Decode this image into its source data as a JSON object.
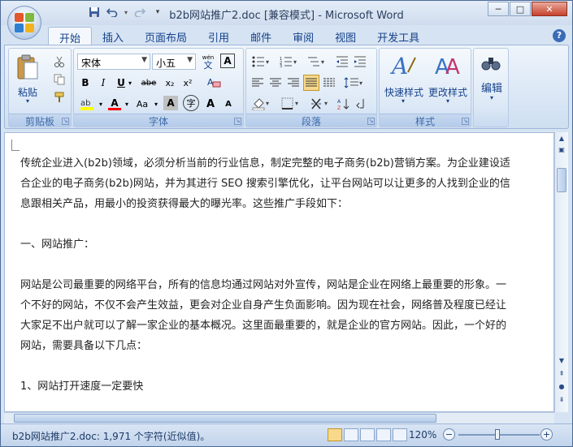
{
  "window": {
    "title": "b2b网站推广2.doc [兼容模式] - Microsoft Word",
    "minimize": "─",
    "maximize": "□",
    "close": "✕"
  },
  "tabs": [
    "开始",
    "插入",
    "页面布局",
    "引用",
    "邮件",
    "审阅",
    "视图",
    "开发工具"
  ],
  "help": "?",
  "ribbon": {
    "clipboard": {
      "label": "剪贴板",
      "paste": "粘贴"
    },
    "font": {
      "label": "字体",
      "font_name": "宋体",
      "font_size": "小五",
      "bold": "B",
      "italic": "I",
      "underline": "U",
      "strike": "abe",
      "subscript": "x₂",
      "superscript": "x²",
      "change_case": "Aa",
      "font_color": "A",
      "grow": "A",
      "shrink": "A",
      "char_border": "A",
      "enclose": "字",
      "wen": "wén",
      "wen_char": "文"
    },
    "paragraph": {
      "label": "段落"
    },
    "styles": {
      "label": "样式",
      "quick_styles": "快速样式",
      "change_styles": "更改样式"
    },
    "editing": {
      "label": "编辑"
    }
  },
  "document": {
    "paragraphs": [
      "传统企业进入(b2b)领域，必须分析当前的行业信息，制定完整的电子商务(b2b)营销方案。为企业建设适",
      "合企业的电子商务(b2b)网站，并为其进行 SEO 搜索引擎优化，让平台网站可以让更多的人找到企业的信",
      "息跟相关产品，用最小的投资获得最大的曝光率。这些推广手段如下：",
      "",
      "一、网站推广：",
      "",
      "网站是公司最重要的网络平台，所有的信息均通过网站对外宣传，网站是企业在网络上最重要的形象。一",
      "个不好的网站，不仅不会产生效益，更会对企业自身产生负面影响。因为现在社会，网络普及程度已经让",
      "大家足不出户就可以了解一家企业的基本概况。这里面最重要的，就是企业的官方网站。因此，一个好的",
      "网站，需要具备以下几点：",
      "",
      "1、网站打开速度一定要快"
    ]
  },
  "statusbar": {
    "doc_info": "b2b网站推广2.doc: 1,971 个字符(近似值)。",
    "zoom": "120%",
    "zoom_minus": "−",
    "zoom_plus": "+"
  }
}
